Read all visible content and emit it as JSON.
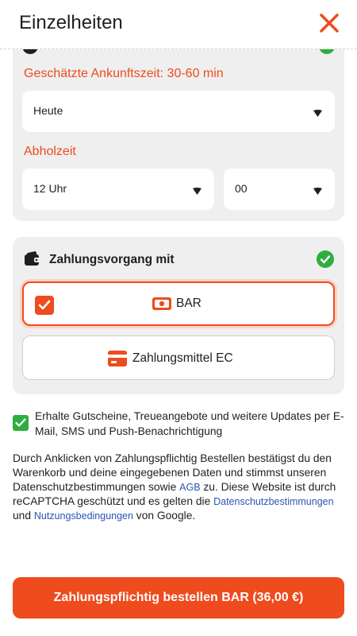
{
  "header": {
    "title": "Einzelheiten",
    "close_icon": "close-icon"
  },
  "delivery": {
    "eta_label": "Geschätzte Ankunftszeit: 30-60 min",
    "day_value": "Heute",
    "pickup_label": "Abholzeit",
    "hour_value": "12 Uhr",
    "minute_value": "00"
  },
  "payment": {
    "title": "Zahlungsvorgang mit",
    "options": [
      {
        "label": "BAR",
        "selected": true,
        "icon": "cash-icon"
      },
      {
        "label": "Zahlungsmittel EC",
        "selected": false,
        "icon": "card-icon"
      }
    ]
  },
  "newsletter": {
    "checked": true,
    "text": "Erhalte Gutscheine, Treueangebote und weitere Updates per E-Mail, SMS und Push-Benachrichtigung"
  },
  "legal": {
    "part1": "Durch Anklicken von Zahlungspflichtig Bestellen bestätigst du den Warenkorb und deine eingegebenen Daten und stimmst unseren Datenschutzbestimmungen sowie ",
    "agb_link": "AGB",
    "part2": " zu. Diese Website ist durch reCAPTCHA geschützt und es gelten die ",
    "privacy_link": "Datenschutzbestimmungen",
    "part3": " und ",
    "terms_link": "Nutzungsbedingungen",
    "part4": " von Google."
  },
  "cta": {
    "label": "Zahlungspflichtig bestellen BAR (36,00 €)"
  },
  "colors": {
    "accent": "#ee4b1e",
    "success": "#2fae3f",
    "card_bg": "#efefef",
    "link": "#2a55b3"
  }
}
